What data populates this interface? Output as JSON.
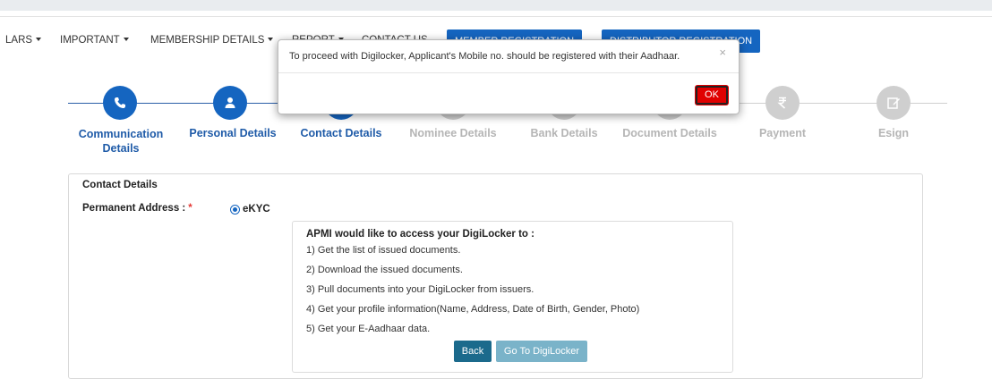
{
  "nav": {
    "items": [
      {
        "label": "LARS",
        "caret": true
      },
      {
        "label": "IMPORTANT",
        "caret": true
      },
      {
        "label": "MEMBERSHIP DETAILS",
        "caret": true
      },
      {
        "label": "REPORT",
        "caret": true
      },
      {
        "label": "CONTACT US",
        "caret": false
      }
    ],
    "buttons": [
      "MEMBER REGISTRATION",
      "DISTRIBUTOR REGISTRATION"
    ]
  },
  "steps": [
    {
      "label_line1": "Communication",
      "label_line2": "Details",
      "state": "done",
      "icon": "phone-icon"
    },
    {
      "label_line1": "Personal Details",
      "label_line2": "",
      "state": "done",
      "icon": "user-icon"
    },
    {
      "label_line1": "Contact Details",
      "label_line2": "",
      "state": "active",
      "icon": "address-icon"
    },
    {
      "label_line1": "Nominee Details",
      "label_line2": "",
      "state": "pending",
      "icon": "nominee-icon"
    },
    {
      "label_line1": "Bank Details",
      "label_line2": "",
      "state": "pending",
      "icon": "bank-icon"
    },
    {
      "label_line1": "Document Details",
      "label_line2": "",
      "state": "pending",
      "icon": "document-icon"
    },
    {
      "label_line1": "Payment",
      "label_line2": "",
      "state": "pending",
      "icon": "rupee-icon"
    },
    {
      "label_line1": "Esign",
      "label_line2": "",
      "state": "pending",
      "icon": "edit-icon"
    }
  ],
  "panel": {
    "title": "Contact Details",
    "permanent_address_label": "Permanent Address :",
    "required_mark": "*",
    "radio_option": "eKYC"
  },
  "digilocker": {
    "heading": "APMI would like to access your DigiLocker to :",
    "items": [
      "1) Get the list of issued documents.",
      "2) Download the issued documents.",
      "3) Pull documents into your DigiLocker from issuers.",
      "4) Get your profile information(Name, Address, Date of Birth, Gender, Photo)",
      "5) Get your E-Aadhaar data."
    ],
    "back_label": "Back",
    "go_label": "Go To DigiLocker"
  },
  "modal": {
    "message": "To proceed with Digilocker, Applicant's Mobile no. should be registered with their Aadhaar.",
    "close_symbol": "×",
    "ok_label": "OK"
  },
  "colors": {
    "primary": "#1565c0",
    "inactive": "#cfcfcf",
    "ok_button": "#e00000",
    "back_button": "#1b6a8c"
  }
}
